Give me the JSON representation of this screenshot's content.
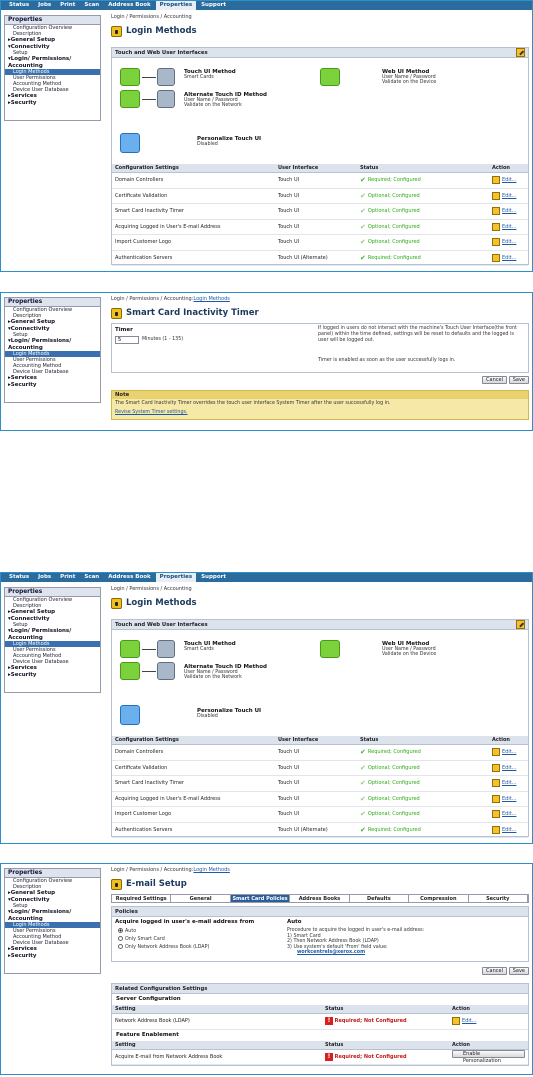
{
  "nav": {
    "tabs": [
      "Status",
      "Jobs",
      "Print",
      "Scan",
      "Address Book",
      "Properties",
      "Support"
    ],
    "active": "Properties"
  },
  "sidebar": {
    "title": "Properties",
    "items": [
      {
        "label": "Configuration Overview",
        "kind": "it"
      },
      {
        "label": "Description",
        "kind": "it"
      },
      {
        "label": "General Setup",
        "kind": "sec",
        "prefix": "▸"
      },
      {
        "label": "Connectivity",
        "kind": "sec",
        "prefix": "▾"
      },
      {
        "label": "Setup",
        "kind": "it"
      },
      {
        "label": "Login/ Permissions/",
        "kind": "sec",
        "prefix": "▾"
      },
      {
        "label": "Accounting",
        "kind": "sec",
        "prefix": ""
      },
      {
        "label": "Login Methods",
        "kind": "it",
        "selected": true
      },
      {
        "label": "User Permissions",
        "kind": "it"
      },
      {
        "label": "Accounting Method",
        "kind": "it"
      },
      {
        "label": "Device User Database",
        "kind": "it"
      },
      {
        "label": "Services",
        "kind": "sec",
        "prefix": "▸"
      },
      {
        "label": "Security",
        "kind": "sec",
        "prefix": "▸"
      }
    ]
  },
  "login": {
    "breadcrumb": "Login / Permissions / Accounting",
    "title": "Login Methods",
    "section": "Touch and Web User Interfaces",
    "touch_title": "Touch UI Method",
    "touch_sub": "Smart Cards",
    "alt_title": "Alternate Touch ID Method",
    "alt_sub1": "User Name / Password",
    "alt_sub2": "Validate on the Network",
    "web_title": "Web UI Method",
    "web_sub1": "User Name / Password",
    "web_sub2": "Validate on the Device",
    "pers_title": "Personalize Touch UI",
    "pers_sub": "Disabled",
    "headers": [
      "Configuration Settings",
      "User Interface",
      "Status",
      "Action"
    ],
    "rows": [
      {
        "setting": "Domain Controllers",
        "ui": "Touch UI",
        "status": "Required; Configured",
        "req": true,
        "action": "Edit..."
      },
      {
        "setting": "Certificate Validation",
        "ui": "Touch UI",
        "status": "Optional; Configured",
        "req": false,
        "action": "Edit..."
      },
      {
        "setting": "Smart Card Inactivity Timer",
        "ui": "Touch UI",
        "status": "Optional; Configured",
        "req": false,
        "action": "Edit..."
      },
      {
        "setting": "Acquiring Logged in User's E-mail Address",
        "ui": "Touch UI",
        "status": "Optional; Configured",
        "req": false,
        "action": "Edit..."
      },
      {
        "setting": "Import Customer Logo",
        "ui": "Touch UI",
        "status": "Optional; Configured",
        "req": false,
        "action": "Edit..."
      },
      {
        "setting": "Authentication Servers",
        "ui": "Touch UI (Alternate)",
        "status": "Required; Configured",
        "req": true,
        "action": "Edit..."
      }
    ]
  },
  "timer": {
    "breadcrumb_prefix": "Login / Permissions / Accounting:",
    "breadcrumb_link": "Login Methods",
    "title": "Smart Card Inactivity Timer",
    "label": "Timer",
    "value": "5",
    "unit": "Minutes (1 - 135)",
    "desc": "If logged in users do not interact with the machine's Touch User Interface(the front panel) within the time defined, settings will be reset to defaults and the logged is user will be logged out.",
    "desc2": "Timer is enabled as soon as the user successfully logs in.",
    "cancel": "Cancel",
    "save": "Save",
    "note_head": "Note",
    "note_text": "The Smart Card Inactivity Timer overrides the touch user interface System Timer after the user successfully log in.",
    "note_link": "Revise System Timer settings."
  },
  "email": {
    "breadcrumb_prefix": "Login / Permissions / Accounting:",
    "breadcrumb_link": "Login Methods",
    "title": "E-mail Setup",
    "tabs": [
      "Required Settings",
      "General",
      "Smart Card Policies",
      "Address Books",
      "Defaults",
      "Compression",
      "Security"
    ],
    "active_tab": "Smart Card Policies",
    "policies": "Policies",
    "acquire_label": "Acquire logged in user's e-mail address from",
    "opt1": "Auto",
    "opt2": "Only Smart Card",
    "opt3": "Only Network Address Book (LDAP)",
    "auto_head": "Auto",
    "proc": "Procedure to acquire the logged in user's e-mail address:",
    "step1": "1) Smart Card",
    "step2": "2) Then Network Address Book (LDAP)",
    "step3": "3) Use system's default 'From' field value:",
    "email_addr": "workcentrels@xerox.com",
    "cancel": "Cancel",
    "save": "Save",
    "related": "Related Configuration Settings",
    "server_cfg": "Server Configuration",
    "h_setting": "Setting",
    "h_status": "Status",
    "h_action": "Action",
    "row1_setting": "Network Address Book (LDAP)",
    "row1_status": "Required; Not Configured",
    "row1_action": "Edit...",
    "feature": "Feature Enablement",
    "row2_setting": "Acquire E-mail from Network Address Book",
    "row2_status": "Required; Not Configured",
    "row2_action": "Enable Personalization"
  }
}
